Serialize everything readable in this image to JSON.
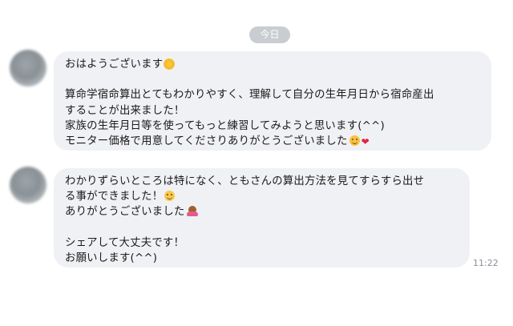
{
  "date_label": "今日",
  "messages": [
    {
      "lines": [
        {
          "text": "おはようございます",
          "emoji": "sun-emoji"
        },
        {
          "text": ""
        },
        {
          "text": "算命学宿命算出とてもわかりやすく、理解して自分の生年月日から宿命産出"
        },
        {
          "text": "することが出来ました！"
        },
        {
          "text": "家族の生年月日等を使ってもっと練習してみようと思います(^^)"
        },
        {
          "text": "モニター価格で用意してくださりありがとうございました",
          "emoji": "relieved-face-emoji, red-heart-emoji"
        }
      ]
    },
    {
      "lines": [
        {
          "text": "わかりずらいところは特になく、ともさんの算出方法を見てすらすら出せ"
        },
        {
          "text": "る事ができました！",
          "emoji": "smiling-face-emoji"
        },
        {
          "text": "ありがとうございました",
          "emoji": "person-bowing-emoji"
        },
        {
          "text": ""
        },
        {
          "text": "シェアして大丈夫です！"
        },
        {
          "text": "お願いします(^^)"
        }
      ]
    }
  ],
  "timestamp": "11:22"
}
